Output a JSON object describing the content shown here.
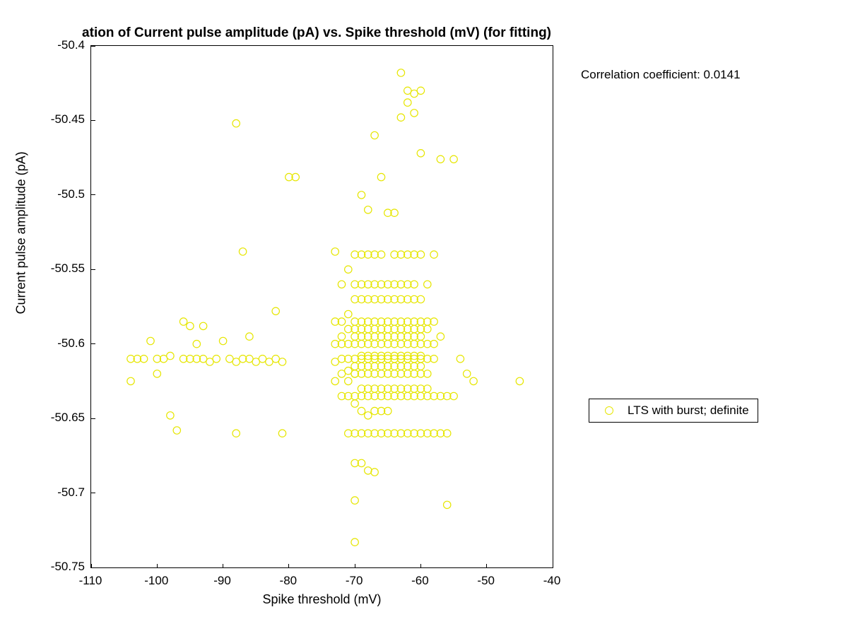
{
  "chart_data": {
    "type": "scatter",
    "title": "ation of Current pulse amplitude (pA) vs. Spike threshold (mV) (for fitting)",
    "xlabel": "Spike threshold (mV)",
    "ylabel": "Current pulse amplitude (pA)",
    "xlim": [
      -110,
      -40
    ],
    "ylim": [
      -50.75,
      -50.4
    ],
    "xticks": [
      -110,
      -100,
      -90,
      -80,
      -70,
      -60,
      -50,
      -40
    ],
    "yticks": [
      -50.75,
      -50.7,
      -50.65,
      -50.6,
      -50.55,
      -50.5,
      -50.45,
      -50.4
    ],
    "annotation": "Correlation coefficient: 0.0141",
    "legend": [
      "LTS with burst; definite"
    ],
    "marker_color": "#e6e600",
    "series": [
      {
        "name": "LTS with burst; definite",
        "points": [
          [
            -104,
            -50.61
          ],
          [
            -104,
            -50.625
          ],
          [
            -103,
            -50.61
          ],
          [
            -102,
            -50.61
          ],
          [
            -101,
            -50.598
          ],
          [
            -100,
            -50.61
          ],
          [
            -100,
            -50.62
          ],
          [
            -99,
            -50.61
          ],
          [
            -98,
            -50.648
          ],
          [
            -98,
            -50.608
          ],
          [
            -97,
            -50.658
          ],
          [
            -96,
            -50.61
          ],
          [
            -96,
            -50.585
          ],
          [
            -95,
            -50.61
          ],
          [
            -95,
            -50.588
          ],
          [
            -94,
            -50.61
          ],
          [
            -94,
            -50.6
          ],
          [
            -93,
            -50.588
          ],
          [
            -93,
            -50.61
          ],
          [
            -92,
            -50.612
          ],
          [
            -91,
            -50.61
          ],
          [
            -90,
            -50.598
          ],
          [
            -89,
            -50.61
          ],
          [
            -88,
            -50.612
          ],
          [
            -88,
            -50.452
          ],
          [
            -88,
            -50.66
          ],
          [
            -87,
            -50.538
          ],
          [
            -87,
            -50.61
          ],
          [
            -86,
            -50.61
          ],
          [
            -86,
            -50.595
          ],
          [
            -85,
            -50.612
          ],
          [
            -84,
            -50.61
          ],
          [
            -83,
            -50.612
          ],
          [
            -82,
            -50.578
          ],
          [
            -82,
            -50.61
          ],
          [
            -81,
            -50.612
          ],
          [
            -81,
            -50.66
          ],
          [
            -80,
            -50.488
          ],
          [
            -79,
            -50.488
          ],
          [
            -73,
            -50.612
          ],
          [
            -73,
            -50.6
          ],
          [
            -73,
            -50.538
          ],
          [
            -73,
            -50.585
          ],
          [
            -73,
            -50.625
          ],
          [
            -72,
            -50.585
          ],
          [
            -72,
            -50.61
          ],
          [
            -72,
            -50.635
          ],
          [
            -72,
            -50.6
          ],
          [
            -72,
            -50.595
          ],
          [
            -72,
            -50.62
          ],
          [
            -72,
            -50.56
          ],
          [
            -71,
            -50.61
          ],
          [
            -71,
            -50.6
          ],
          [
            -71,
            -50.59
          ],
          [
            -71,
            -50.635
          ],
          [
            -71,
            -50.618
          ],
          [
            -71,
            -50.625
          ],
          [
            -71,
            -50.66
          ],
          [
            -71,
            -50.55
          ],
          [
            -71,
            -50.58
          ],
          [
            -70,
            -50.61
          ],
          [
            -70,
            -50.6
          ],
          [
            -70,
            -50.615
          ],
          [
            -70,
            -50.635
          ],
          [
            -70,
            -50.62
          ],
          [
            -70,
            -50.595
          ],
          [
            -70,
            -50.59
          ],
          [
            -70,
            -50.66
          ],
          [
            -70,
            -50.56
          ],
          [
            -70,
            -50.585
          ],
          [
            -70,
            -50.57
          ],
          [
            -70,
            -50.54
          ],
          [
            -70,
            -50.62
          ],
          [
            -70,
            -50.68
          ],
          [
            -70,
            -50.64
          ],
          [
            -70,
            -50.705
          ],
          [
            -70,
            -50.733
          ],
          [
            -69,
            -50.61
          ],
          [
            -69,
            -50.6
          ],
          [
            -69,
            -50.615
          ],
          [
            -69,
            -50.62
          ],
          [
            -69,
            -50.635
          ],
          [
            -69,
            -50.595
          ],
          [
            -69,
            -50.59
          ],
          [
            -69,
            -50.585
          ],
          [
            -69,
            -50.66
          ],
          [
            -69,
            -50.63
          ],
          [
            -69,
            -50.57
          ],
          [
            -69,
            -50.56
          ],
          [
            -69,
            -50.54
          ],
          [
            -69,
            -50.608
          ],
          [
            -69,
            -50.68
          ],
          [
            -69,
            -50.5
          ],
          [
            -69,
            -50.645
          ],
          [
            -68,
            -50.61
          ],
          [
            -68,
            -50.6
          ],
          [
            -68,
            -50.615
          ],
          [
            -68,
            -50.62
          ],
          [
            -68,
            -50.635
          ],
          [
            -68,
            -50.595
          ],
          [
            -68,
            -50.59
          ],
          [
            -68,
            -50.585
          ],
          [
            -68,
            -50.66
          ],
          [
            -68,
            -50.63
          ],
          [
            -68,
            -50.57
          ],
          [
            -68,
            -50.56
          ],
          [
            -68,
            -50.608
          ],
          [
            -68,
            -50.54
          ],
          [
            -68,
            -50.648
          ],
          [
            -68,
            -50.685
          ],
          [
            -68,
            -50.51
          ],
          [
            -67,
            -50.61
          ],
          [
            -67,
            -50.6
          ],
          [
            -67,
            -50.615
          ],
          [
            -67,
            -50.62
          ],
          [
            -67,
            -50.635
          ],
          [
            -67,
            -50.595
          ],
          [
            -67,
            -50.59
          ],
          [
            -67,
            -50.585
          ],
          [
            -67,
            -50.66
          ],
          [
            -67,
            -50.63
          ],
          [
            -67,
            -50.57
          ],
          [
            -67,
            -50.56
          ],
          [
            -67,
            -50.608
          ],
          [
            -67,
            -50.686
          ],
          [
            -67,
            -50.645
          ],
          [
            -67,
            -50.54
          ],
          [
            -67,
            -50.46
          ],
          [
            -66,
            -50.61
          ],
          [
            -66,
            -50.6
          ],
          [
            -66,
            -50.615
          ],
          [
            -66,
            -50.62
          ],
          [
            -66,
            -50.635
          ],
          [
            -66,
            -50.595
          ],
          [
            -66,
            -50.59
          ],
          [
            -66,
            -50.585
          ],
          [
            -66,
            -50.66
          ],
          [
            -66,
            -50.63
          ],
          [
            -66,
            -50.57
          ],
          [
            -66,
            -50.56
          ],
          [
            -66,
            -50.608
          ],
          [
            -66,
            -50.645
          ],
          [
            -66,
            -50.54
          ],
          [
            -66,
            -50.488
          ],
          [
            -65,
            -50.61
          ],
          [
            -65,
            -50.6
          ],
          [
            -65,
            -50.615
          ],
          [
            -65,
            -50.62
          ],
          [
            -65,
            -50.635
          ],
          [
            -65,
            -50.595
          ],
          [
            -65,
            -50.59
          ],
          [
            -65,
            -50.585
          ],
          [
            -65,
            -50.66
          ],
          [
            -65,
            -50.63
          ],
          [
            -65,
            -50.57
          ],
          [
            -65,
            -50.56
          ],
          [
            -65,
            -50.608
          ],
          [
            -65,
            -50.512
          ],
          [
            -65,
            -50.645
          ],
          [
            -64,
            -50.61
          ],
          [
            -64,
            -50.6
          ],
          [
            -64,
            -50.615
          ],
          [
            -64,
            -50.62
          ],
          [
            -64,
            -50.635
          ],
          [
            -64,
            -50.595
          ],
          [
            -64,
            -50.59
          ],
          [
            -64,
            -50.585
          ],
          [
            -64,
            -50.66
          ],
          [
            -64,
            -50.63
          ],
          [
            -64,
            -50.57
          ],
          [
            -64,
            -50.56
          ],
          [
            -64,
            -50.608
          ],
          [
            -64,
            -50.54
          ],
          [
            -64,
            -50.512
          ],
          [
            -63,
            -50.61
          ],
          [
            -63,
            -50.6
          ],
          [
            -63,
            -50.615
          ],
          [
            -63,
            -50.62
          ],
          [
            -63,
            -50.635
          ],
          [
            -63,
            -50.595
          ],
          [
            -63,
            -50.59
          ],
          [
            -63,
            -50.585
          ],
          [
            -63,
            -50.66
          ],
          [
            -63,
            -50.63
          ],
          [
            -63,
            -50.57
          ],
          [
            -63,
            -50.56
          ],
          [
            -63,
            -50.608
          ],
          [
            -63,
            -50.54
          ],
          [
            -63,
            -50.448
          ],
          [
            -63,
            -50.418
          ],
          [
            -62,
            -50.61
          ],
          [
            -62,
            -50.6
          ],
          [
            -62,
            -50.615
          ],
          [
            -62,
            -50.62
          ],
          [
            -62,
            -50.635
          ],
          [
            -62,
            -50.595
          ],
          [
            -62,
            -50.59
          ],
          [
            -62,
            -50.585
          ],
          [
            -62,
            -50.66
          ],
          [
            -62,
            -50.63
          ],
          [
            -62,
            -50.57
          ],
          [
            -62,
            -50.56
          ],
          [
            -62,
            -50.608
          ],
          [
            -62,
            -50.54
          ],
          [
            -62,
            -50.438
          ],
          [
            -62,
            -50.43
          ],
          [
            -61,
            -50.61
          ],
          [
            -61,
            -50.6
          ],
          [
            -61,
            -50.615
          ],
          [
            -61,
            -50.62
          ],
          [
            -61,
            -50.635
          ],
          [
            -61,
            -50.595
          ],
          [
            -61,
            -50.59
          ],
          [
            -61,
            -50.585
          ],
          [
            -61,
            -50.66
          ],
          [
            -61,
            -50.63
          ],
          [
            -61,
            -50.57
          ],
          [
            -61,
            -50.56
          ],
          [
            -61,
            -50.608
          ],
          [
            -61,
            -50.54
          ],
          [
            -61,
            -50.445
          ],
          [
            -61,
            -50.432
          ],
          [
            -60,
            -50.61
          ],
          [
            -60,
            -50.6
          ],
          [
            -60,
            -50.615
          ],
          [
            -60,
            -50.62
          ],
          [
            -60,
            -50.635
          ],
          [
            -60,
            -50.595
          ],
          [
            -60,
            -50.59
          ],
          [
            -60,
            -50.585
          ],
          [
            -60,
            -50.66
          ],
          [
            -60,
            -50.63
          ],
          [
            -60,
            -50.57
          ],
          [
            -60,
            -50.608
          ],
          [
            -60,
            -50.54
          ],
          [
            -60,
            -50.472
          ],
          [
            -60,
            -50.43
          ],
          [
            -59,
            -50.61
          ],
          [
            -59,
            -50.6
          ],
          [
            -59,
            -50.62
          ],
          [
            -59,
            -50.635
          ],
          [
            -59,
            -50.585
          ],
          [
            -59,
            -50.66
          ],
          [
            -59,
            -50.63
          ],
          [
            -59,
            -50.59
          ],
          [
            -59,
            -50.56
          ],
          [
            -58,
            -50.61
          ],
          [
            -58,
            -50.635
          ],
          [
            -58,
            -50.585
          ],
          [
            -58,
            -50.66
          ],
          [
            -58,
            -50.6
          ],
          [
            -58,
            -50.54
          ],
          [
            -57,
            -50.635
          ],
          [
            -57,
            -50.66
          ],
          [
            -57,
            -50.476
          ],
          [
            -57,
            -50.595
          ],
          [
            -56,
            -50.66
          ],
          [
            -56,
            -50.635
          ],
          [
            -56,
            -50.708
          ],
          [
            -55,
            -50.635
          ],
          [
            -55,
            -50.476
          ],
          [
            -54,
            -50.61
          ],
          [
            -53,
            -50.62
          ],
          [
            -52,
            -50.625
          ],
          [
            -45,
            -50.625
          ]
        ]
      }
    ]
  }
}
